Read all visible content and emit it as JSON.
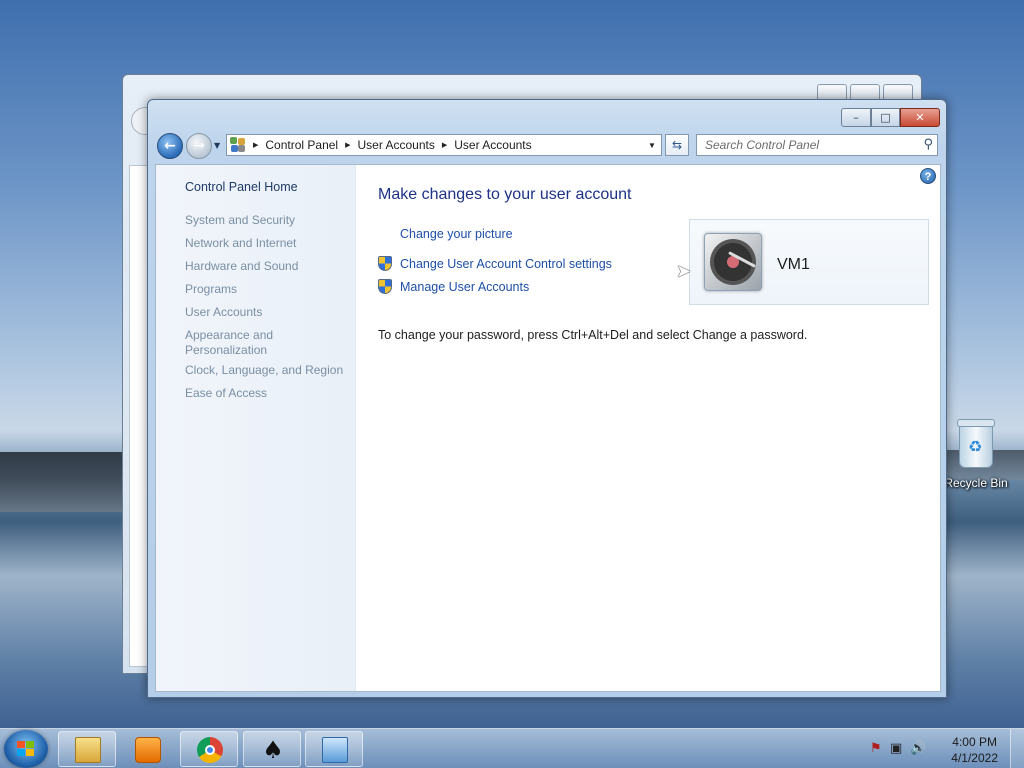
{
  "desktop": {
    "recycle_bin_label": "Recycle Bin"
  },
  "window": {
    "controls": {
      "minimize": "–",
      "maximize": "□",
      "close": "✕"
    },
    "address": {
      "crumbs": [
        "Control Panel",
        "User Accounts",
        "User Accounts"
      ]
    },
    "search": {
      "placeholder": "Search Control Panel"
    }
  },
  "left_pane": {
    "home": "Control Panel Home",
    "categories": [
      "System and Security",
      "Network and Internet",
      "Hardware and Sound",
      "Programs",
      "User Accounts",
      "Appearance and Personalization",
      "Clock, Language, and Region",
      "Ease of Access"
    ]
  },
  "main": {
    "title": "Make changes to your user account",
    "links": {
      "change_picture": "Change your picture",
      "uac_settings": "Change User Account Control settings",
      "manage_accounts": "Manage User Accounts"
    },
    "info": "To change your password, press Ctrl+Alt+Del and select Change a password.",
    "account": {
      "name": "VM1"
    },
    "help": "?"
  },
  "taskbar": {
    "apps": [
      "Windows Explorer",
      "Windows Media Player",
      "Google Chrome",
      "Solitaire",
      "Control Panel"
    ],
    "clock": {
      "time": "4:00 PM",
      "date": "4/1/2022"
    }
  },
  "colors": {
    "link": "#1e4fa8",
    "title": "#1e3287",
    "category": "#7a8ea3",
    "close_button": "#c74a33"
  },
  "icons": {
    "back": "back-arrow-icon",
    "forward": "forward-arrow-icon",
    "refresh": "refresh-icon",
    "search": "search-icon",
    "shield": "uac-shield-icon",
    "help": "help-icon"
  }
}
